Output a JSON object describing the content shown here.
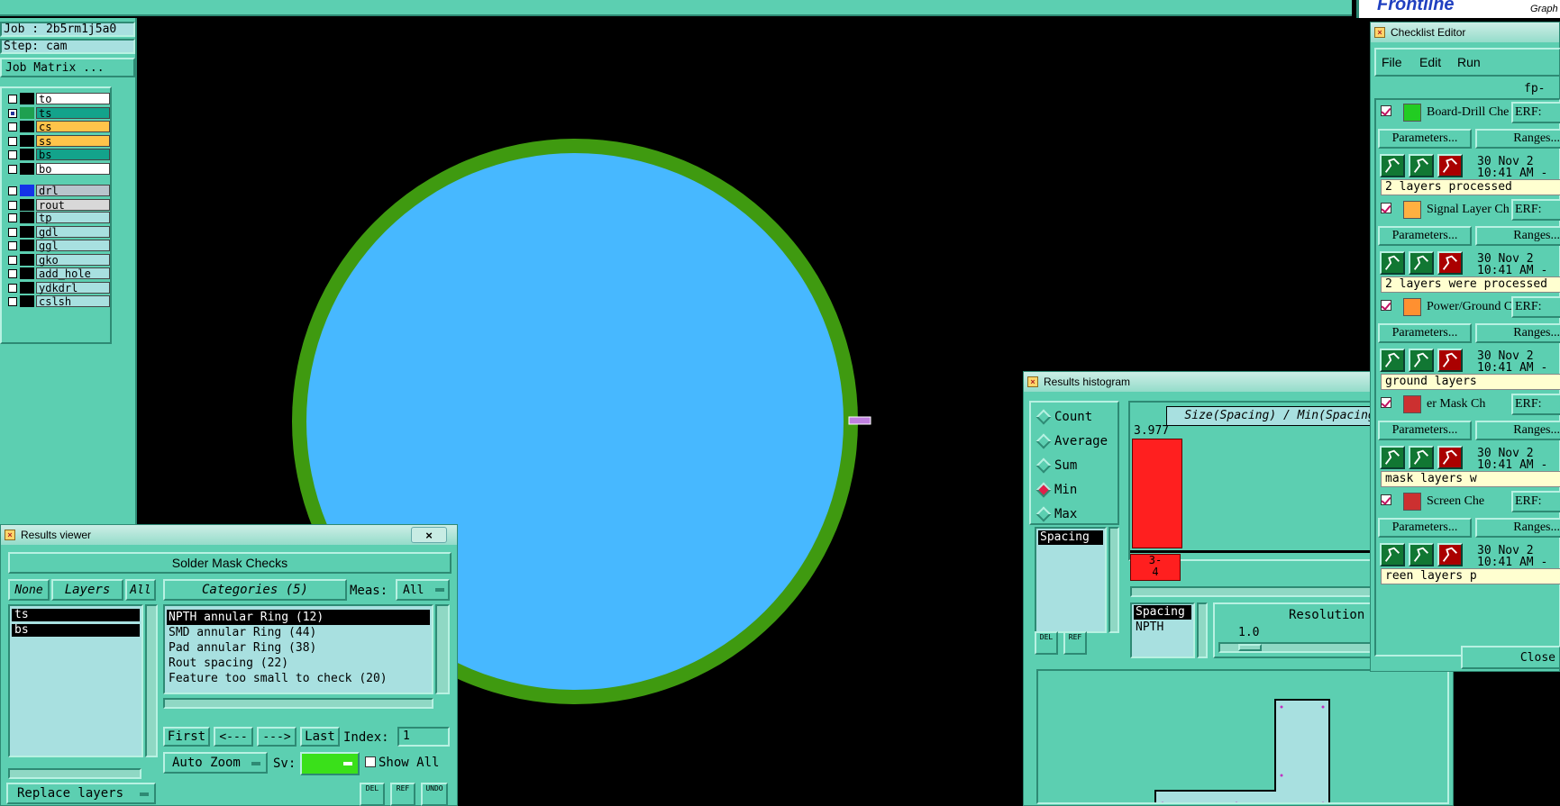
{
  "app": {
    "brand": "Frontline",
    "brand_sub": "Graph"
  },
  "job": {
    "job_label": "Job : 2b5rm1j5a0",
    "step_label": "Step: cam",
    "matrix_button": "Job Matrix ..."
  },
  "layers": {
    "group1": [
      {
        "name": "to",
        "color": "#ffffff",
        "checked": false,
        "swatch": "#000000"
      },
      {
        "name": "ts",
        "color": "#13a38b",
        "checked": true,
        "swatch": "#1ea050"
      },
      {
        "name": "cs",
        "color": "#ffc44a",
        "checked": false,
        "swatch": "#000000"
      },
      {
        "name": "ss",
        "color": "#ffc44a",
        "checked": false,
        "swatch": "#000000"
      },
      {
        "name": "bs",
        "color": "#13a38b",
        "checked": false,
        "swatch": "#000000"
      },
      {
        "name": "bo",
        "color": "#ffffff",
        "checked": false,
        "swatch": "#000000"
      }
    ],
    "group2": [
      {
        "name": "drl",
        "color": "#b8c4cc",
        "checked": false,
        "swatch": "#1433e8"
      },
      {
        "name": "rout",
        "color": "#d8d8d8",
        "checked": false,
        "swatch": "#000000"
      }
    ],
    "group3": [
      {
        "name": "tp",
        "color": "#a8e0e0",
        "checked": false,
        "swatch": "#000000"
      },
      {
        "name": "gdl",
        "color": "#a8e0e0",
        "checked": false,
        "swatch": "#000000"
      },
      {
        "name": "ggl",
        "color": "#a8e0e0",
        "checked": false,
        "swatch": "#000000"
      },
      {
        "name": "gko",
        "color": "#a8e0e0",
        "checked": false,
        "swatch": "#000000"
      },
      {
        "name": "add_hole",
        "color": "#a8e0e0",
        "checked": false,
        "swatch": "#000000"
      },
      {
        "name": "ydkdrl",
        "color": "#a8e0e0",
        "checked": false,
        "swatch": "#000000"
      },
      {
        "name": "cslsh",
        "color": "#a8e0e0",
        "checked": false,
        "swatch": "#000000"
      }
    ]
  },
  "canvas": {
    "pad_fill": "#47b8ff",
    "ring_color": "#3f9a10"
  },
  "results_viewer": {
    "title": "Results viewer",
    "close": "×",
    "header": "Solder Mask Checks",
    "none_btn": "None",
    "layers_btn": "Layers",
    "all_btn": "All",
    "categories_btn": "Categories (5)",
    "meas_label": "Meas:",
    "meas_value": "All",
    "layer_list": [
      "ts",
      "bs"
    ],
    "categories": [
      "NPTH annular Ring (12)",
      "SMD annular Ring (44)",
      "Pad annular Ring (38)",
      "Rout spacing (22)",
      "Feature too small to check (20)"
    ],
    "first_btn": "First",
    "prev_btn": "<---",
    "next_btn": "--->",
    "last_btn": "Last",
    "index_label": "Index:",
    "index_value": "1",
    "zoom_value": "Auto Zoom",
    "sv_label": "Sv:",
    "show_all_label": "Show All",
    "replace_value": "Replace layers",
    "del_btn": "DEL",
    "ref_btn": "REF",
    "undo_btn": "UNDO"
  },
  "histogram": {
    "title": "Results histogram",
    "close": "×",
    "modes": [
      {
        "label": "Count",
        "on": false
      },
      {
        "label": "Average",
        "on": false
      },
      {
        "label": "Sum",
        "on": false
      },
      {
        "label": "Min",
        "on": true
      },
      {
        "label": "Max",
        "on": false
      }
    ],
    "metric_list": [
      "Spacing"
    ],
    "chart_title": "Size(Spacing) / Min(Spacing)",
    "bar_value": "3.977",
    "bin_label": "3-\n4",
    "del_btn": "DEL",
    "ref_btn": "REF",
    "info_list": [
      "Spacing",
      "NPTH"
    ],
    "resolution_label": "Resolution",
    "resolution_value": "1.0"
  },
  "checklist": {
    "title": "Checklist Editor",
    "menu": [
      "File",
      "Edit",
      "Run"
    ],
    "name": "fp-qa",
    "close_btn": "Close",
    "params_btn": "Parameters...",
    "ranges_btn": "Ranges...",
    "erf_btn": "ERF:",
    "items": [
      {
        "name": "Board-Drill Che",
        "date": "30 Nov 2\n10:41 AM -",
        "msg": "2 layers processed",
        "icon_color": "#22cc22"
      },
      {
        "name": "Signal Layer Ch",
        "date": "30 Nov 2\n10:41 AM -",
        "msg": "2 layers were processed",
        "icon_color": "#ffb040"
      },
      {
        "name": "Power/Ground C",
        "date": "30 Nov 2\n10:41 AM -",
        "msg": "ground layers",
        "icon_color": "#ff9030"
      },
      {
        "name": "er Mask Ch",
        "date": "30 Nov 2\n10:41 AM -",
        "msg": "mask layers w",
        "icon_color": "#cc3030"
      },
      {
        "name": "Screen Che",
        "date": "30 Nov 2\n10:41 AM -",
        "msg": "reen layers p",
        "icon_color": "#cc3030"
      }
    ]
  }
}
